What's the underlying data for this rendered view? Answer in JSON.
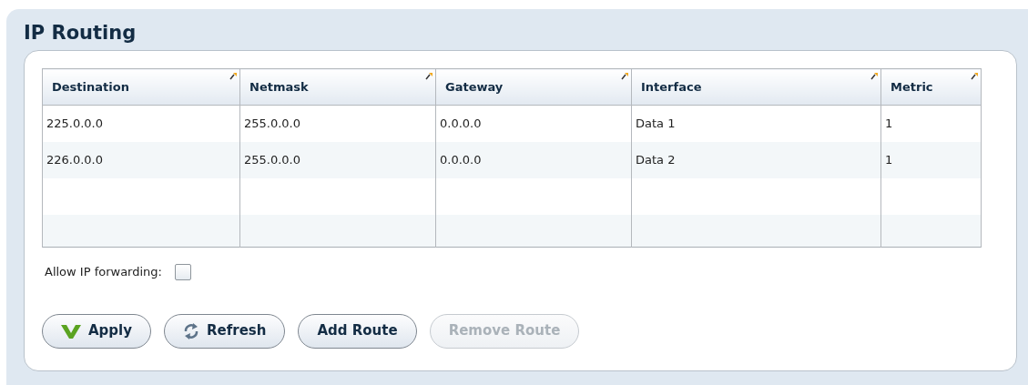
{
  "panel": {
    "title": "IP Routing"
  },
  "table": {
    "columns": [
      "Destination",
      "Netmask",
      "Gateway",
      "Interface",
      "Metric"
    ],
    "rows": [
      [
        "225.0.0.0",
        "255.0.0.0",
        "0.0.0.0",
        "Data 1",
        "1"
      ],
      [
        "226.0.0.0",
        "255.0.0.0",
        "0.0.0.0",
        "Data 2",
        "1"
      ]
    ]
  },
  "forwarding": {
    "label": "Allow IP forwarding:",
    "checked": false
  },
  "buttons": [
    {
      "label": "Apply",
      "kind": "confirm",
      "disabled": false
    },
    {
      "label": "Refresh",
      "kind": "reload",
      "disabled": false
    },
    {
      "label": "Add Route",
      "kind": "plain",
      "disabled": false
    },
    {
      "label": "Remove Route",
      "kind": "plain",
      "disabled": true
    }
  ]
}
